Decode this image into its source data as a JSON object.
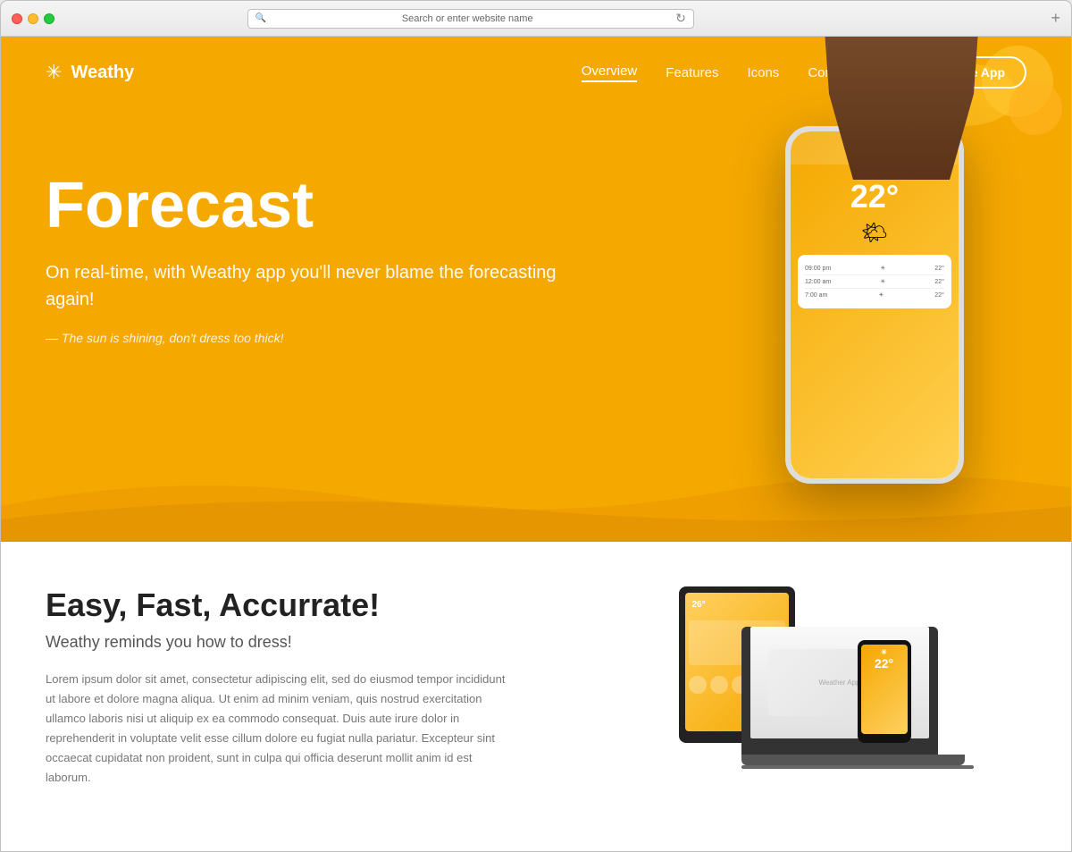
{
  "browser": {
    "address_bar_text": "Search or enter website name"
  },
  "navbar": {
    "logo_text": "Weathy",
    "nav_links": [
      {
        "label": "Overview",
        "active": true
      },
      {
        "label": "Features",
        "active": false
      },
      {
        "label": "Icons",
        "active": false
      },
      {
        "label": "Compatibility",
        "active": false
      }
    ],
    "cta_button": "Get the App"
  },
  "hero": {
    "title": "Forecast",
    "subtitle": "On real-time, with Weathy app you'll never blame the forecasting again!",
    "tagline": "— The sun is shining, don't dress too thick!",
    "phone_weather_type": "Sunny",
    "phone_temp": "22°",
    "phone_rows": [
      {
        "time": "09:00 pm",
        "icon": "☀",
        "temp": "22°"
      },
      {
        "time": "12:00 am",
        "icon": "☀",
        "temp": "22°"
      },
      {
        "time": "7:00 am",
        "icon": "☀",
        "temp": "22°"
      }
    ]
  },
  "features": {
    "title": "Easy, Fast, Accurrate!",
    "subtitle": "Weathy reminds you how to dress!",
    "body": "Lorem ipsum dolor sit amet, consectetur adipiscing elit, sed do eiusmod tempor incididunt ut labore et dolore magna aliqua. Ut enim ad minim veniam, quis nostrud exercitation ullamco laboris nisi ut aliquip ex ea commodo consequat. Duis aute irure dolor in reprehenderit in voluptate velit esse cillum dolore eu fugiat nulla pariatur. Excepteur sint occaecat cupidatat non proident, sunt in culpa qui officia deserunt mollit anim id est laborum."
  },
  "colors": {
    "hero_bg": "#F5A800",
    "hero_bg_dark": "#E09500",
    "white": "#ffffff",
    "text_dark": "#222222",
    "text_mid": "#555555",
    "text_light": "#777777"
  }
}
